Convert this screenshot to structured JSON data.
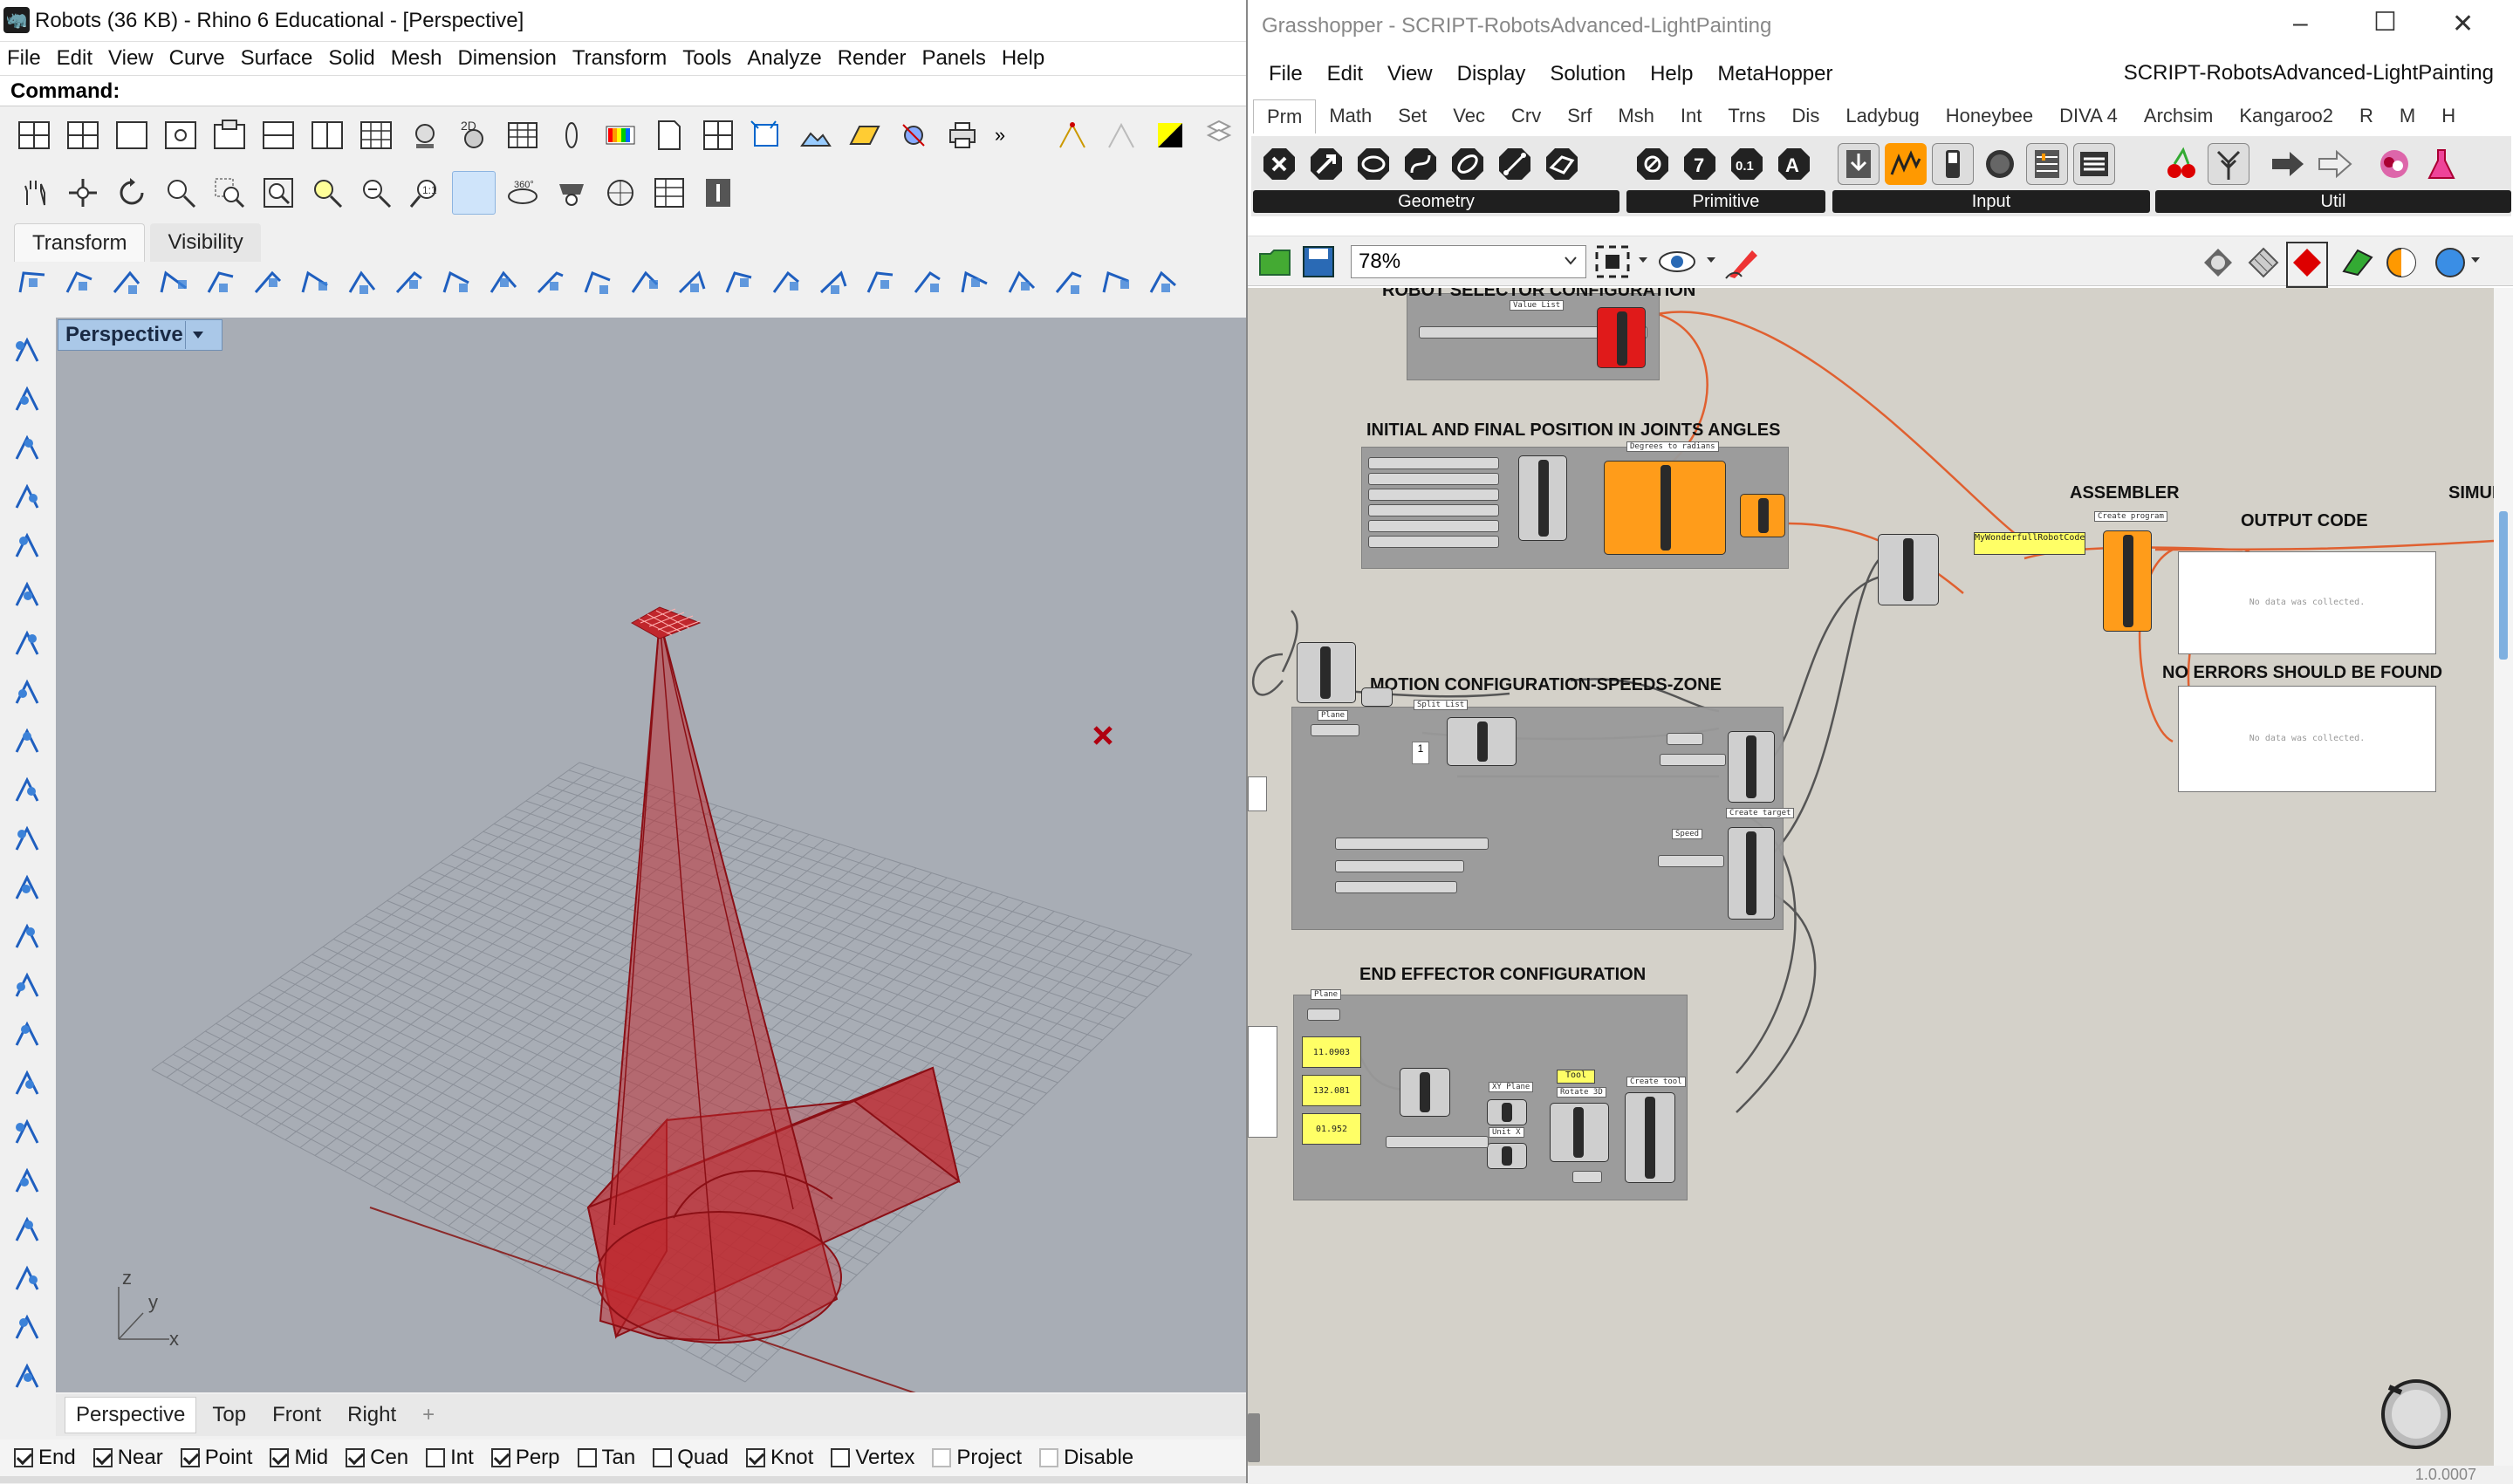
{
  "rhino": {
    "title": "Robots (36 KB) - Rhino 6 Educational - [Perspective]",
    "menu": [
      "File",
      "Edit",
      "View",
      "Curve",
      "Surface",
      "Solid",
      "Mesh",
      "Dimension",
      "Transform",
      "Tools",
      "Analyze",
      "Render",
      "Panels",
      "Help"
    ],
    "command_label": "Command:",
    "command_value": "",
    "toolbar_tabs": [
      "Transform",
      "Visibility"
    ],
    "viewport_label": "Perspective",
    "viewport_tabs": [
      "Perspective",
      "Top",
      "Front",
      "Right"
    ],
    "add_tab": "+",
    "axis": {
      "x": "x",
      "y": "y",
      "z": "z"
    },
    "osnaps": [
      {
        "label": "End",
        "checked": true
      },
      {
        "label": "Near",
        "checked": true
      },
      {
        "label": "Point",
        "checked": true
      },
      {
        "label": "Mid",
        "checked": true
      },
      {
        "label": "Cen",
        "checked": true
      },
      {
        "label": "Int",
        "checked": false
      },
      {
        "label": "Perp",
        "checked": true
      },
      {
        "label": "Tan",
        "checked": false
      },
      {
        "label": "Quad",
        "checked": false
      },
      {
        "label": "Knot",
        "checked": true
      },
      {
        "label": "Vertex",
        "checked": false
      },
      {
        "label": "Project",
        "checked": false,
        "disabled": true
      },
      {
        "label": "Disable",
        "checked": false,
        "disabled": true
      }
    ],
    "colors": {
      "object": "#c0262c",
      "viewport_bg": "#a8adb5",
      "label_bg": "#aac8e8"
    }
  },
  "grasshopper": {
    "title": "Grasshopper - SCRIPT-RobotsAdvanced-LightPainting",
    "menu": [
      "File",
      "Edit",
      "View",
      "Display",
      "Solution",
      "Help",
      "MetaHopper"
    ],
    "document_name": "SCRIPT-RobotsAdvanced-LightPainting",
    "tabs": [
      "Prm",
      "Math",
      "Set",
      "Vec",
      "Crv",
      "Srf",
      "Msh",
      "Int",
      "Trns",
      "Dis",
      "Ladybug",
      "Honeybee",
      "DIVA 4",
      "Archsim",
      "Kangaroo2",
      "R",
      "M",
      "H"
    ],
    "ribbon_groups": [
      "Geometry",
      "Primitive",
      "Input",
      "Util"
    ],
    "zoom": "78%",
    "groups": {
      "robot_selector": "ROBOT SELECTOR CONFIGURATION",
      "initial_final": "INITIAL AND FINAL POSITION IN JOINTS ANGLES",
      "motion": "MOTION CONFIGURATION-SPEEDS-ZONE",
      "end_effector": "END EFFECTOR CONFIGURATION",
      "assembler": "ASSEMBLER",
      "output_code": "OUTPUT CODE",
      "no_errors": "NO ERRORS SHOULD BE FOUND",
      "simulation": "SIMUL"
    },
    "panels": {
      "output_empty": "No data was collected.",
      "errors_empty": "No data was collected.",
      "program_name": "MyWonderfullRobotCode"
    },
    "component_tags": {
      "value_list": "Value List",
      "degrees": "Degrees to radians",
      "create_program": "Create program",
      "split_list": "Split List",
      "create_target": "Create target",
      "plane": "Plane",
      "xy_plane": "XY Plane",
      "unit_x": "Unit X",
      "rotate3d": "Rotate 3D",
      "create_tool": "Create tool",
      "tool": "Tool",
      "one": "1",
      "speed": "Speed"
    },
    "number_panels": [
      "11.0903",
      "132.081",
      "01.952"
    ],
    "version": "1.0.0007"
  }
}
